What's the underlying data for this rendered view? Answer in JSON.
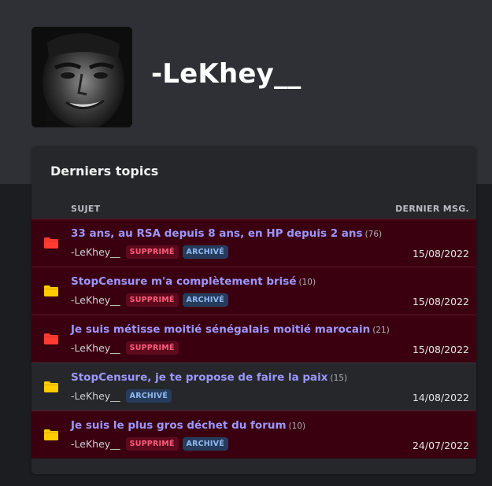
{
  "profile": {
    "username": "-LeKhey__",
    "avatar_icon": "profile-photo"
  },
  "topics_card": {
    "title": "Derniers topics",
    "col_subject": "SUJET",
    "col_last_msg": "DERNIER MSG.",
    "rows": [
      {
        "title": "33 ans, au RSA depuis 8 ans, en HP depuis 2 ans",
        "count": "(76)",
        "author": "-LeKhey__",
        "deleted": "SUPPRIMÉ",
        "archived": "ARCHIVÉ",
        "date": "15/08/2022",
        "folder_color": "#ff3b30",
        "row_deleted": true
      },
      {
        "title": "StopCensure m'a complètement brisé",
        "count": "(10)",
        "author": "-LeKhey__",
        "deleted": "SUPPRIMÉ",
        "archived": "ARCHIVÉ",
        "date": "15/08/2022",
        "folder_color": "#ffcc00",
        "row_deleted": true
      },
      {
        "title": "Je suis métisse moitié sénégalais moitié marocain",
        "count": "(21)",
        "author": "-LeKhey__",
        "deleted": "SUPPRIMÉ",
        "archived": null,
        "date": "15/08/2022",
        "folder_color": "#ff3b30",
        "row_deleted": true
      },
      {
        "title": "StopCensure, je te propose de faire la paix",
        "count": "(15)",
        "author": "-LeKhey__",
        "deleted": null,
        "archived": "ARCHIVÉ",
        "date": "14/08/2022",
        "folder_color": "#ffcc00",
        "row_deleted": false
      },
      {
        "title": "Je suis le plus gros déchet du forum",
        "count": "(10)",
        "author": "-LeKhey__",
        "deleted": "SUPPRIMÉ",
        "archived": "ARCHIVÉ",
        "date": "24/07/2022",
        "folder_color": "#ffcc00",
        "row_deleted": true
      }
    ]
  },
  "colors": {
    "link": "#9c97ff",
    "deleted_row_bg": "#3a0010",
    "badge_deleted_fg": "#ff5c7d",
    "badge_archived_fg": "#8fb8f0"
  }
}
